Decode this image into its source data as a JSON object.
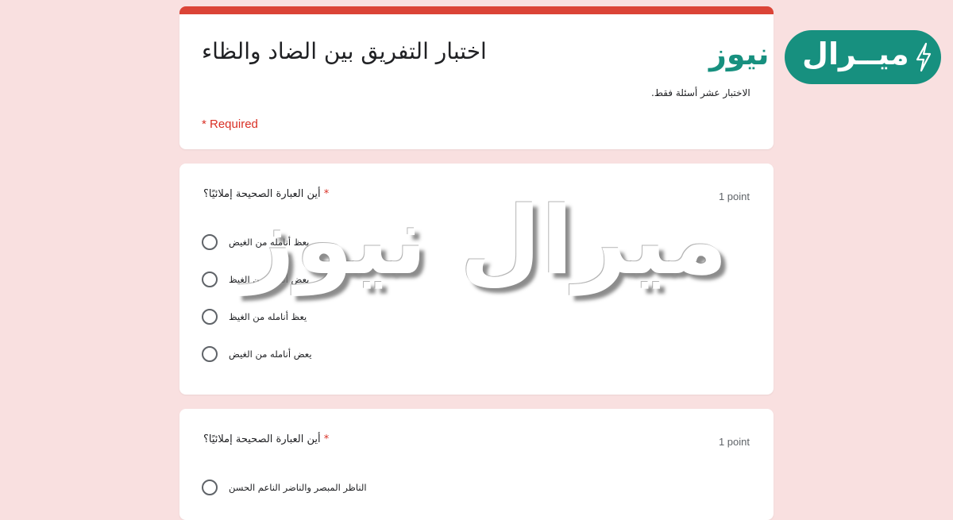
{
  "form": {
    "title": "اختبار التفريق بين الضاد والظاء",
    "description": "الاختبار عشر أسئلة فقط.",
    "required_note": "* Required"
  },
  "questions": [
    {
      "title": "أين العبارة الصحيحة إملائيًا؟",
      "required_mark": "*",
      "points": "1 point",
      "options": [
        "يعظ أنامله من الغيض",
        "يعض أنامله من الغيظ",
        "يعظ أنامله من الغيظ",
        "يعض أنامله من الغيض"
      ]
    },
    {
      "title": "أين العبارة الصحيحة إملائيًا؟",
      "required_mark": "*",
      "points": "1 point",
      "options": [
        "الناظر المبصر والناضر الناعم الحسن"
      ]
    }
  ],
  "watermark": {
    "text": "ميرال نيوز"
  },
  "logo": {
    "pill_text": "ميــرال",
    "word": "نيوز"
  },
  "colors": {
    "background": "#f9e0e0",
    "accent_red": "#db4437",
    "required_red": "#d93025",
    "logo_teal": "#17907f"
  }
}
